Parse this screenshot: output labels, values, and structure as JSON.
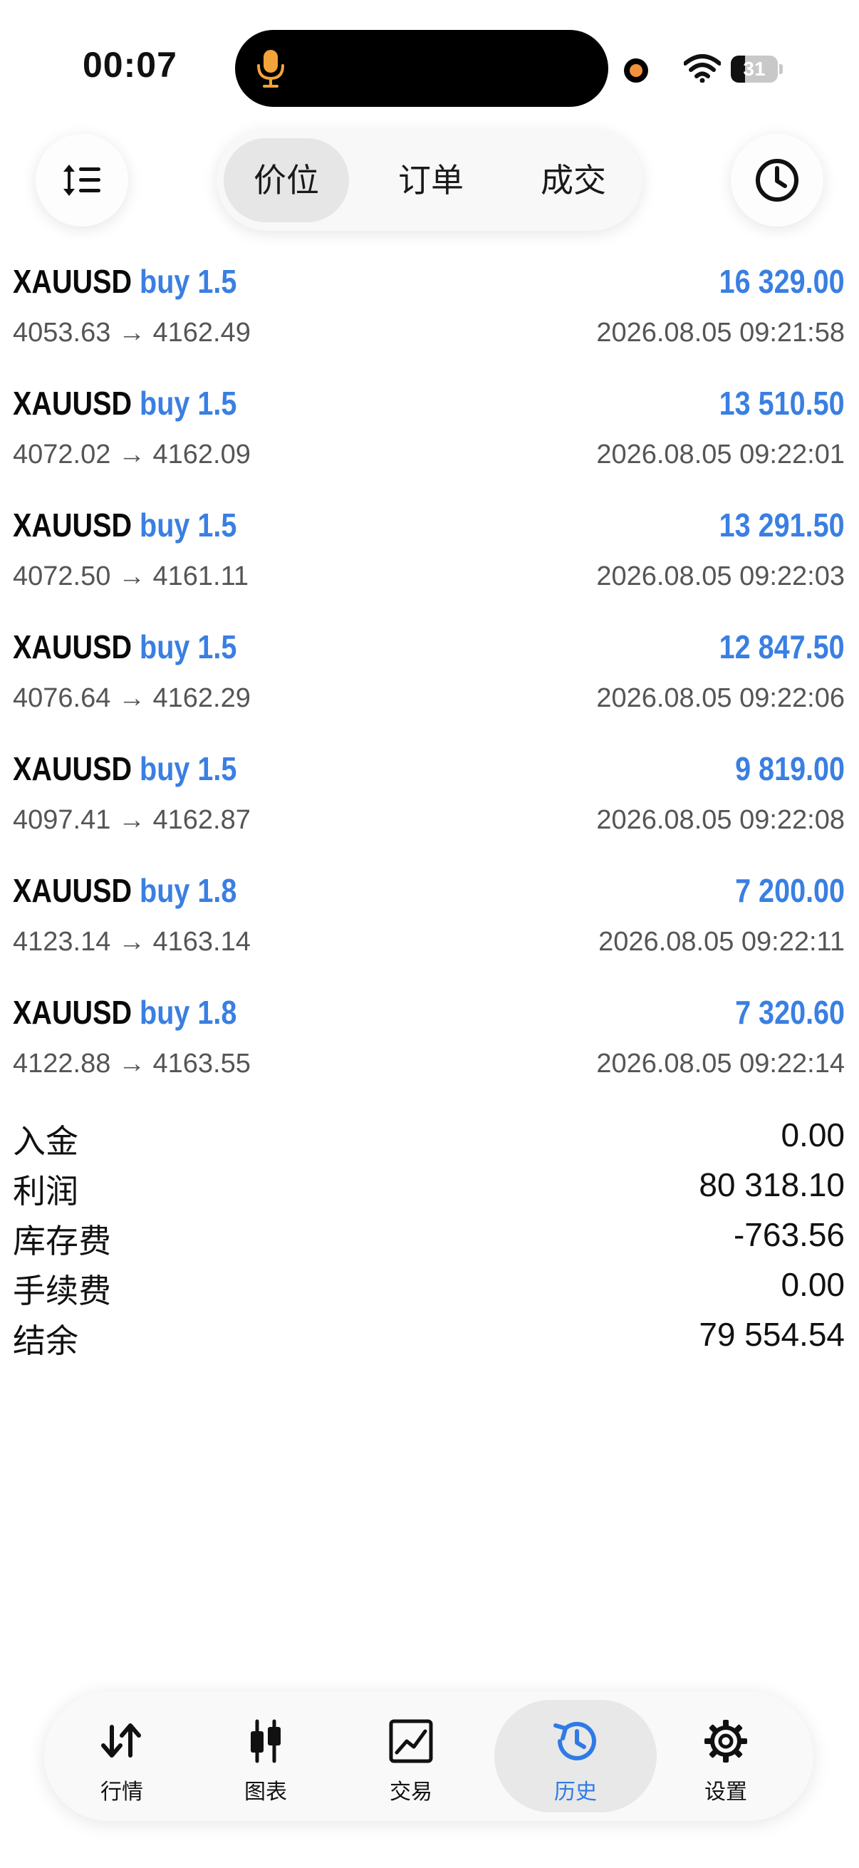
{
  "status_bar": {
    "time": "00:07",
    "battery_level": "31",
    "battery_fraction": 0.31
  },
  "header": {
    "tabs": [
      {
        "label": "价位",
        "active": true
      },
      {
        "label": "订单",
        "active": false
      },
      {
        "label": "成交",
        "active": false
      }
    ],
    "left_icon": "sort-list-icon",
    "right_icon": "clock-icon"
  },
  "deals": [
    {
      "symbol": "XAUUSD",
      "type": "buy",
      "volume": "1.5",
      "open_price": "4053.63",
      "arrow": "→",
      "close_price": "4162.49",
      "profit": "16 329.00",
      "time": "2026.08.05 09:21:58"
    },
    {
      "symbol": "XAUUSD",
      "type": "buy",
      "volume": "1.5",
      "open_price": "4072.02",
      "arrow": "→",
      "close_price": "4162.09",
      "profit": "13 510.50",
      "time": "2026.08.05 09:22:01"
    },
    {
      "symbol": "XAUUSD",
      "type": "buy",
      "volume": "1.5",
      "open_price": "4072.50",
      "arrow": "→",
      "close_price": "4161.11",
      "profit": "13 291.50",
      "time": "2026.08.05 09:22:03"
    },
    {
      "symbol": "XAUUSD",
      "type": "buy",
      "volume": "1.5",
      "open_price": "4076.64",
      "arrow": "→",
      "close_price": "4162.29",
      "profit": "12 847.50",
      "time": "2026.08.05 09:22:06"
    },
    {
      "symbol": "XAUUSD",
      "type": "buy",
      "volume": "1.5",
      "open_price": "4097.41",
      "arrow": "→",
      "close_price": "4162.87",
      "profit": "9 819.00",
      "time": "2026.08.05 09:22:08"
    },
    {
      "symbol": "XAUUSD",
      "type": "buy",
      "volume": "1.8",
      "open_price": "4123.14",
      "arrow": "→",
      "close_price": "4163.14",
      "profit": "7 200.00",
      "time": "2026.08.05 09:22:11"
    },
    {
      "symbol": "XAUUSD",
      "type": "buy",
      "volume": "1.8",
      "open_price": "4122.88",
      "arrow": "→",
      "close_price": "4163.55",
      "profit": "7 320.60",
      "time": "2026.08.05 09:22:14"
    }
  ],
  "summary": [
    {
      "label": "入金",
      "value": "0.00"
    },
    {
      "label": "利润",
      "value": "80 318.10"
    },
    {
      "label": "库存费",
      "value": "-763.56"
    },
    {
      "label": "手续费",
      "value": "0.00"
    },
    {
      "label": "结余",
      "value": "79 554.54"
    }
  ],
  "bottom_nav": [
    {
      "label": "行情",
      "icon": "quotes-arrows-icon",
      "active": false
    },
    {
      "label": "图表",
      "icon": "candlestick-chart-icon",
      "active": false
    },
    {
      "label": "交易",
      "icon": "trade-chart-icon",
      "active": false
    },
    {
      "label": "历史",
      "icon": "history-clock-icon",
      "active": true
    },
    {
      "label": "设置",
      "icon": "gear-icon",
      "active": false
    }
  ],
  "colors": {
    "accent": "#3a7fe2",
    "nav_active": "#2f7ae5",
    "mic": "#f2a33a",
    "recording_dot": "#f2913d"
  }
}
